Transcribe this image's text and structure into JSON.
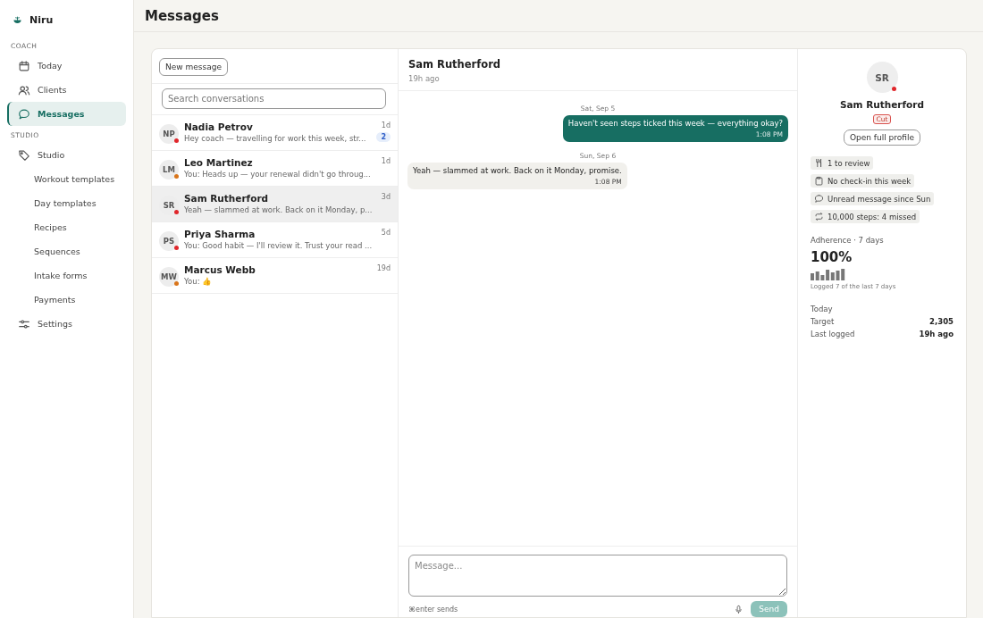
{
  "brand": "Niru",
  "sidebar": {
    "sections": [
      {
        "label": "COACH",
        "items": [
          {
            "label": "Today",
            "kind": "calendar",
            "selected": false
          },
          {
            "label": "Clients",
            "kind": "people",
            "selected": false
          },
          {
            "label": "Messages",
            "kind": "chat",
            "selected": true
          }
        ]
      },
      {
        "label": "STUDIO",
        "items": [
          {
            "label": "Studio",
            "kind": "tag",
            "selected": false
          },
          {
            "label": "Workout templates",
            "kind": "sub",
            "selected": false
          },
          {
            "label": "Day templates",
            "kind": "sub",
            "selected": false
          },
          {
            "label": "Recipes",
            "kind": "sub",
            "selected": false
          },
          {
            "label": "Sequences",
            "kind": "sub",
            "selected": false
          },
          {
            "label": "Intake forms",
            "kind": "sub",
            "selected": false
          },
          {
            "label": "Payments",
            "kind": "sub",
            "selected": false
          },
          {
            "label": "Settings",
            "kind": "sliders",
            "selected": false
          }
        ]
      }
    ]
  },
  "page_title": "Messages",
  "new_message_button": "New message",
  "search": {
    "placeholder": "Search conversations"
  },
  "conversations": [
    {
      "initials": "NP",
      "name": "Nadia Petrov",
      "preview": "Hey coach — travelling for work this week, str...",
      "time": "1d",
      "unread": "2",
      "color": "#e0262b",
      "selected": false
    },
    {
      "initials": "LM",
      "name": "Leo Martinez",
      "preview": "You: Heads up — your renewal didn't go throug...",
      "time": "1d",
      "color": "#d9751a",
      "selected": false
    },
    {
      "initials": "SR",
      "name": "Sam Rutherford",
      "preview": "Yeah — slammed at work. Back on it Monday, p...",
      "time": "3d",
      "color": "#e0262b",
      "selected": true
    },
    {
      "initials": "PS",
      "name": "Priya Sharma",
      "preview": "You: Good habit — I'll review it. Trust your read ...",
      "time": "5d",
      "color": "#e0262b",
      "selected": false
    },
    {
      "initials": "MW",
      "name": "Marcus Webb",
      "preview": "You: 👍",
      "time": "19d",
      "color": "#d9751a",
      "selected": false
    }
  ],
  "chat": {
    "name": "Sam Rutherford",
    "subtitle": "19h ago",
    "messages": [
      {
        "date": "Sat, Sep 5",
        "text": "Haven't seen steps ticked this week — everything okay?",
        "time": "1:08 PM",
        "kind": "outgoing"
      },
      {
        "date": "Sun, Sep 6",
        "text": "Yeah — slammed at work. Back on it Monday, promise.",
        "time": "1:08 PM",
        "kind": "incoming"
      }
    ],
    "composer": {
      "placeholder": "Message...",
      "hint": "⌘enter sends",
      "send": "Send",
      "send_disabled": true
    }
  },
  "profile": {
    "initials": "SR",
    "color": "#e0262b",
    "name": "Sam Rutherford",
    "phase": "Cut",
    "open_button": "Open full profile",
    "flags": [
      {
        "kind": "food",
        "label": "1 to review"
      },
      {
        "kind": "clipboard",
        "label": "No check-in this week"
      },
      {
        "kind": "chat",
        "label": "Unread message since Sun"
      },
      {
        "kind": "repeat",
        "label": "10,000 steps: 4 missed"
      }
    ],
    "adherence": {
      "label": "Adherence · 7 days",
      "value": "100%",
      "note": "Logged 7 of the last 7 days"
    },
    "today": {
      "label": "Today",
      "rows": [
        {
          "label": "Target",
          "value": "2,305"
        },
        {
          "label": "Last logged",
          "value": "19h ago"
        }
      ]
    }
  }
}
